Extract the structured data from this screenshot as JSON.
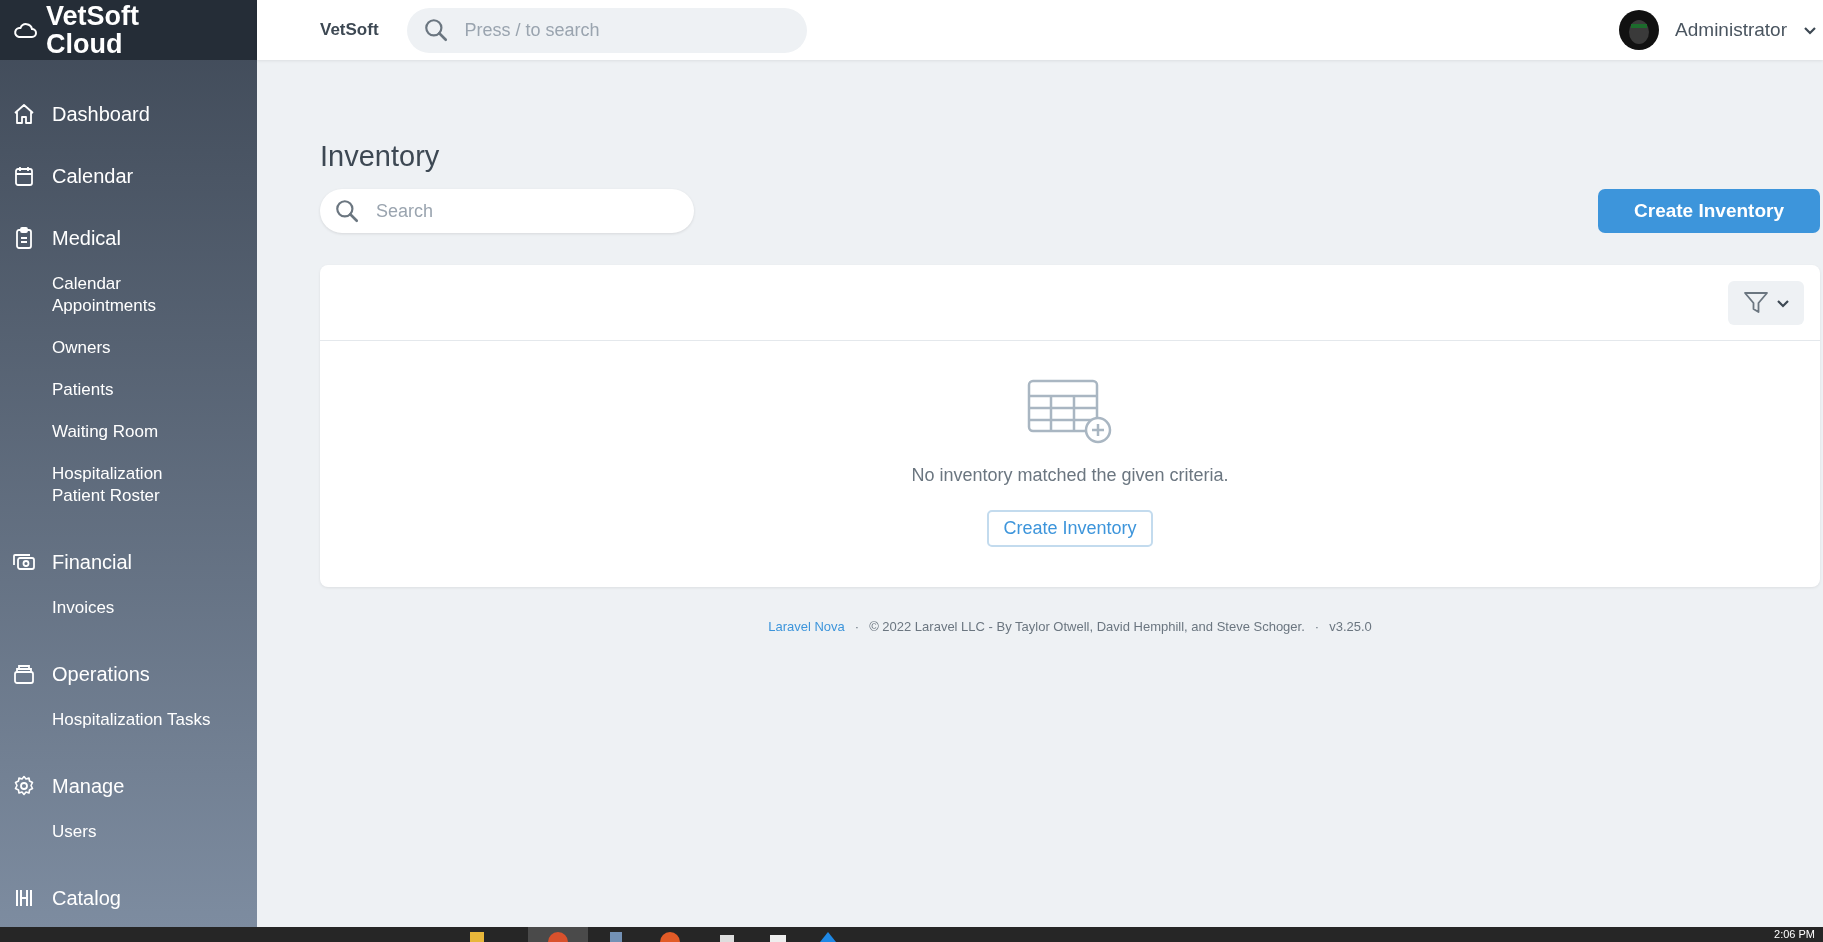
{
  "sidebar": {
    "brand": "VetSoft Cloud",
    "sections": [
      {
        "label": "Dashboard"
      },
      {
        "label": "Calendar"
      },
      {
        "label": "Medical",
        "items": [
          "Calendar Appointments",
          "Owners",
          "Patients",
          "Waiting Room",
          "Hospitalization Patient Roster"
        ]
      },
      {
        "label": "Financial",
        "items": [
          "Invoices"
        ]
      },
      {
        "label": "Operations",
        "items": [
          "Hospitalization Tasks"
        ]
      },
      {
        "label": "Manage",
        "items": [
          "Users"
        ]
      },
      {
        "label": "Catalog"
      }
    ]
  },
  "topbar": {
    "brand": "VetSoft",
    "search": {
      "placeholder": "Press / to search"
    },
    "user": "Administrator"
  },
  "page": {
    "title": "Inventory",
    "search": {
      "placeholder": "Search"
    },
    "create_button": "Create Inventory",
    "empty": {
      "message": "No inventory matched the given criteria.",
      "button": "Create Inventory"
    }
  },
  "footer": [
    {
      "kind": "link",
      "text": "Laravel Nova"
    },
    {
      "kind": "separator",
      "text": "·"
    },
    {
      "kind": "text",
      "text": "© 2022 Laravel LLC - By Taylor Otwell, David Hemphill, and Steve Schoger."
    },
    {
      "kind": "separator",
      "text": "·"
    },
    {
      "kind": "text",
      "text": "v3.25.0"
    }
  ],
  "taskbar": {
    "clock": "2:06 PM"
  }
}
